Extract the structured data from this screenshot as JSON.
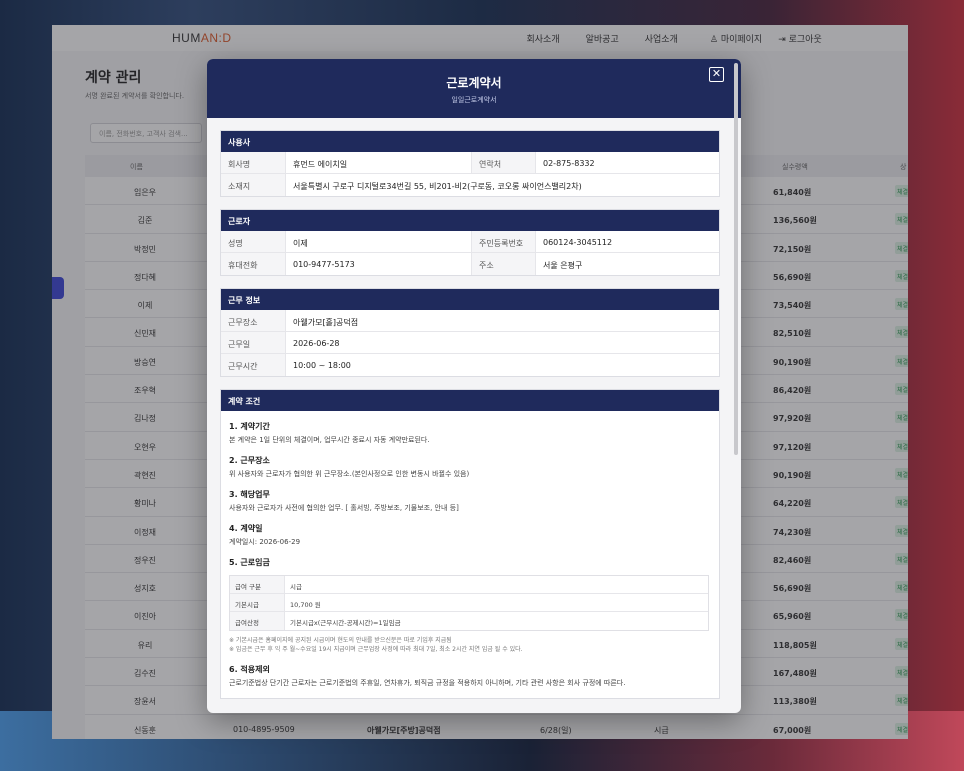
{
  "app": {
    "logo_pre": "HUM",
    "logo_accent": "AN:D",
    "nav": [
      "회사소개",
      "알바공고",
      "사업소개"
    ],
    "mypage": "마이페이지",
    "logout": "로그아웃",
    "page_title": "계약 관리",
    "page_sub": "서명 완료된 계약서를 확인합니다.",
    "search_placeholder": "이름, 전화번호, 고객사 검색...",
    "col_name": "이름",
    "col_amount": "실수령액",
    "col_status": "상",
    "status_tag": "체결",
    "rows": [
      {
        "name": "임은우",
        "amount": "61,840원"
      },
      {
        "name": "김준",
        "amount": "136,560원"
      },
      {
        "name": "박정민",
        "amount": "72,150원"
      },
      {
        "name": "정다혜",
        "amount": "56,690원"
      },
      {
        "name": "이제",
        "amount": "73,540원"
      },
      {
        "name": "신민재",
        "amount": "82,510원"
      },
      {
        "name": "방승연",
        "amount": "90,190원"
      },
      {
        "name": "조우혁",
        "amount": "86,420원"
      },
      {
        "name": "김나정",
        "amount": "97,920원"
      },
      {
        "name": "오현우",
        "amount": "97,120원"
      },
      {
        "name": "곽현진",
        "amount": "90,190원"
      },
      {
        "name": "황미나",
        "amount": "64,220원"
      },
      {
        "name": "이정재",
        "amount": "74,230원"
      },
      {
        "name": "정우진",
        "amount": "82,460원"
      },
      {
        "name": "성지호",
        "amount": "56,690원"
      },
      {
        "name": "이진아",
        "amount": "65,960원"
      },
      {
        "name": "유리",
        "amount": "118,805원"
      },
      {
        "name": "김수진",
        "amount": "167,480원"
      },
      {
        "name": "장윤서",
        "amount": "113,380원"
      },
      {
        "name": "신동훈",
        "amount": "67,000원",
        "phone": "010-4895-9509",
        "place": "아웰가모[주방]공덕점",
        "date": "6/28(일)",
        "paytype": "시급"
      }
    ]
  },
  "modal": {
    "title": "근로계약서",
    "subtitle": "일일근로계약서",
    "close": "✕",
    "employer": {
      "title": "사용사",
      "company_label": "회사명",
      "company": "휴먼드 에이치일",
      "contact_label": "연락처",
      "contact": "02-875-8332",
      "address_label": "소재지",
      "address": "서울특별시 구로구 디지털로34번길 55, 비201-비2(구로동, 코오롱 싸이언스밸리2차)"
    },
    "worker": {
      "title": "근로자",
      "name_label": "성명",
      "name": "이제",
      "rrn_label": "주민등록번호",
      "rrn": "060124-3045112",
      "phone_label": "휴대전화",
      "phone": "010-9477-5173",
      "addr_label": "주소",
      "addr": "서울 은평구"
    },
    "work": {
      "title": "근무 정보",
      "place_label": "근무장소",
      "place": "아웰가모[홀]공덕점",
      "date_label": "근무일",
      "date": "2026-06-28",
      "time_label": "근무시간",
      "time": "10:00 ~ 18:00"
    },
    "terms": {
      "title": "계약 조건",
      "t1_h": "1. 계약기간",
      "t1_p": "본 계약은 1일 단위의 체결이며, 업무시간 종료시 자동 계약만료된다.",
      "t2_h": "2. 근무장소",
      "t2_p": "위 사용자와 근로자가 협의한 위 근무장소.(본인사정으로 인한 변동시 바뀔수 있음)",
      "t3_h": "3. 해당업무",
      "t3_p": "사용자와 근로자가 사전에 협의한 업무. [ 홀서빙, 주방보조, 기물보조, 안내 등]",
      "t4_h": "4. 계약일",
      "t4_p": "계약일시: 2026-06-29",
      "t5_h": "5. 근로임금",
      "wage_type_label": "급여 구분",
      "wage_type": "시급",
      "base_label": "기본시급",
      "base": "10,700 원",
      "calc_label": "급여산정",
      "calc": "기본시급x(근무시간-공제시간)=1일임금",
      "note1": "※ 기본시급은 홈페이지에 공지된 시급이며 현도의 안내를 받으신분은 따로 기입후 지급됨",
      "note2": "※ 임금은 근무 후 익 주 월~수요일 19시 지급이며 근무업장 사정에 따라 최대 7일, 최소 2시간 지연 입금 될 수 있다.",
      "t6_h": "6. 적용제외",
      "t6_p": "근로기준법상 단기간 근로자는 근로기준법의 주휴일, 연차휴가, 퇴직금 규정을 적용하지 아니하며, 기타 관련 사항은 회사 규정에 따른다."
    }
  }
}
